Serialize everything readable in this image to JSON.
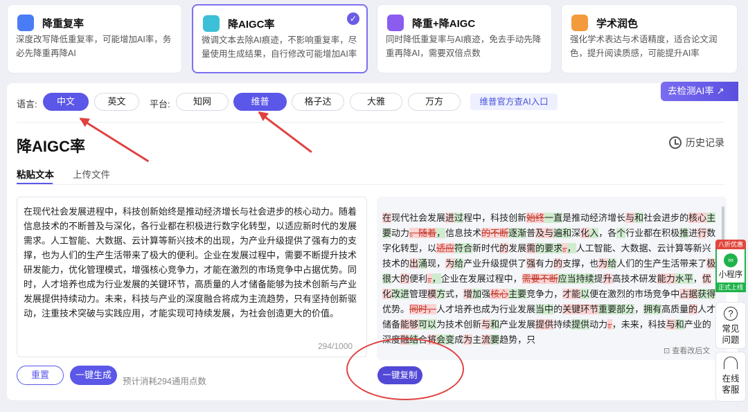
{
  "modes": [
    {
      "title": "降重复率",
      "desc": "深度改写降低重复率，可能增加AI率，务必先降重再降AI",
      "color": "#4a7cf6"
    },
    {
      "title": "降AIGC率",
      "desc": "微调文本去除AI痕迹，不影响重复率，尽量使用生成结果，自行修改可能增加AI率",
      "color": "#3cc0d8"
    },
    {
      "title": "降重+降AIGC",
      "desc": "同时降低重复率与AI痕迹，免去手动先降重再降AI，需要双倍点数",
      "color": "#8a5cf0"
    },
    {
      "title": "学术润色",
      "desc": "强化学术表达与术语精度，适合论文润色，提升阅读质感，可能提升AI率",
      "color": "#f39a3c"
    }
  ],
  "detect_label": "去检测AI率 ↗",
  "lang_label": "语言:",
  "langs": [
    "中文",
    "英文"
  ],
  "platform_label": "平台:",
  "platforms": [
    "知网",
    "维普",
    "格子达",
    "大雅",
    "万方"
  ],
  "official_link": "维普官方查AI入口",
  "page_title": "降AIGC率",
  "history": "历史记录",
  "tabs": [
    "粘贴文本",
    "上传文件"
  ],
  "input_text": "在现代社会发展进程中，科技创新始终是推动经济增长与社会进步的核心动力。随着信息技术的不断普及与深化，各行业都在积极进行数字化转型，以适应新时代的发展需求。人工智能、大数据、云计算等新兴技术的出现，为产业升级提供了强有力的支撑，也为人们的生产生活带来了极大的便利。企业在发展过程中，需要不断提升技术研发能力，优化管理模式，增强核心竞争力，才能在激烈的市场竞争中占据优势。同时，人才培养也成为行业发展的关键环节，高质量的人才储备能够为技术创新与产业发展提供持续动力。未来，科技与产业的深度融合将成为主流趋势，只有坚持创新驱动，注重技术突破与实践应用，才能实现可持续发展，为社会创造更大的价值。",
  "counter": "294/1000",
  "view_changes": "查看改后文",
  "btn_reset": "重置",
  "btn_generate": "一键生成",
  "cost_text": "预计消耗294通用点数",
  "btn_copy": "一键复制",
  "mini_tag": "八折优惠",
  "mini_label": "小程序",
  "mini_bottom": "正式上线",
  "faq": "常见问题",
  "service": "在线客服"
}
